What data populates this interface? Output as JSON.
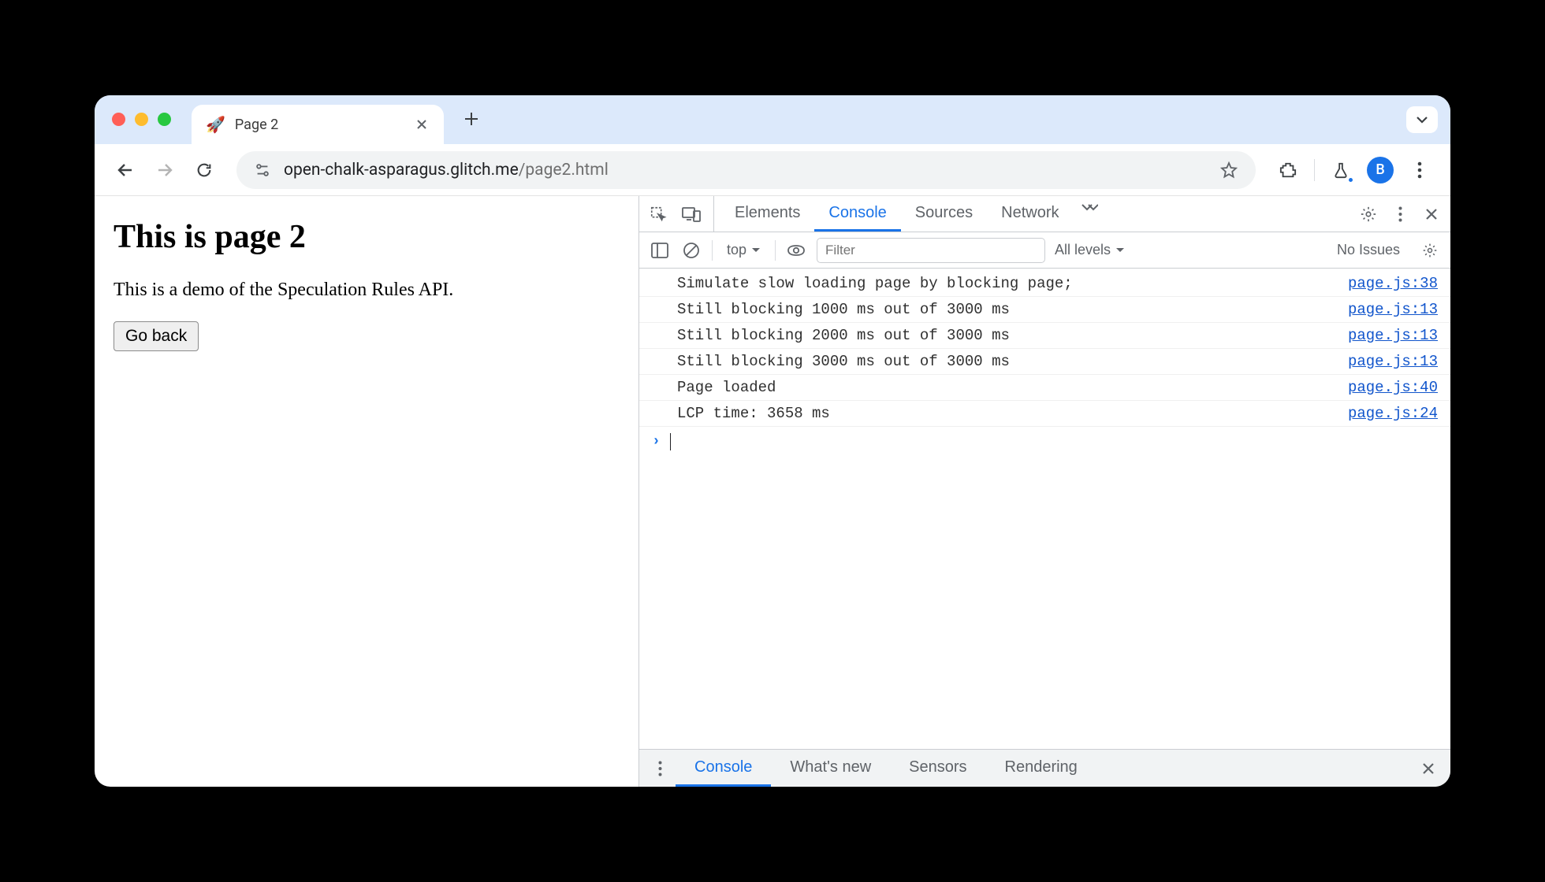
{
  "tab": {
    "favicon": "🚀",
    "title": "Page 2"
  },
  "toolbar": {
    "url_domain": "open-chalk-asparagus.glitch.me",
    "url_path": "/page2.html"
  },
  "avatar_initial": "B",
  "page": {
    "heading": "This is page 2",
    "paragraph": "This is a demo of the Speculation Rules API.",
    "back_button": "Go back"
  },
  "devtools": {
    "tabs": [
      "Elements",
      "Console",
      "Sources",
      "Network"
    ],
    "active_tab": "Console",
    "console_toolbar": {
      "context": "top",
      "filter_placeholder": "Filter",
      "levels": "All levels",
      "issues": "No Issues"
    },
    "messages": [
      {
        "text": "Simulate slow loading page by blocking page;",
        "src": "page.js:38"
      },
      {
        "text": "Still blocking 1000 ms out of 3000 ms",
        "src": "page.js:13"
      },
      {
        "text": "Still blocking 2000 ms out of 3000 ms",
        "src": "page.js:13"
      },
      {
        "text": "Still blocking 3000 ms out of 3000 ms",
        "src": "page.js:13"
      },
      {
        "text": "Page loaded",
        "src": "page.js:40"
      },
      {
        "text": "LCP time: 3658 ms",
        "src": "page.js:24"
      }
    ],
    "drawer_tabs": [
      "Console",
      "What's new",
      "Sensors",
      "Rendering"
    ],
    "drawer_active": "Console"
  }
}
